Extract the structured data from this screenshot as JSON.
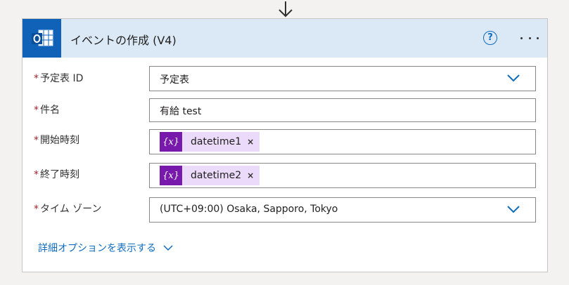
{
  "card": {
    "title": "イベントの作成 (V4)",
    "help_label": "?"
  },
  "fields": {
    "calendar": {
      "required_mark": "*",
      "label": "予定表 ID",
      "value": "予定表"
    },
    "subject": {
      "required_mark": "*",
      "label": "件名",
      "value": "有給 test"
    },
    "start": {
      "required_mark": "*",
      "label": "開始時刻",
      "token_icon": "{x}",
      "token": "datetime1",
      "remove": "×"
    },
    "end": {
      "required_mark": "*",
      "label": "終了時刻",
      "token_icon": "{x}",
      "token": "datetime2",
      "remove": "×"
    },
    "timezone": {
      "required_mark": "*",
      "label": "タイム ゾーン",
      "value": "(UTC+09:00) Osaka, Sapporo, Tokyo"
    }
  },
  "advanced_options": "詳細オプションを表示する",
  "colors": {
    "header_bg": "#dbe9f6",
    "app_icon_bg": "#0f62b8",
    "accent": "#0f6cbd",
    "required": "#a4262c",
    "token_bg": "#ebdaf9",
    "token_icon_bg": "#7719aa"
  },
  "icons": {
    "flow_arrow": "arrow-down-icon",
    "app": "outlook-calendar-icon",
    "help": "help-icon",
    "more": "more-options-icon",
    "dropdown": "chevron-down-icon",
    "token_var": "variable-icon"
  }
}
